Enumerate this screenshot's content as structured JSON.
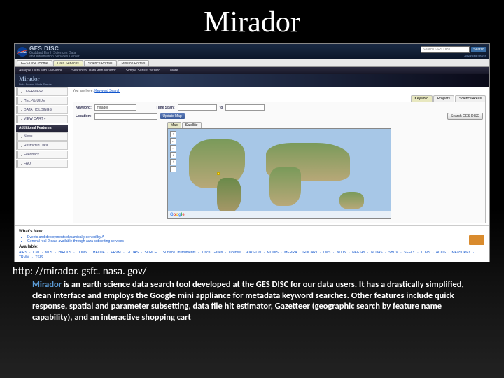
{
  "slide": {
    "title": "Mirador",
    "url": "http: //mirador. gsfc. nasa. gov/",
    "desc_link": "Mirador",
    "desc_rest": " is an earth science data search tool developed at the GES DISC for our data users. It has a drastically simplified, clean interface and employs the Google mini appliance for metadata keyword searches. Other features include quick response, spatial and parameter subsetting, data file hit estimator, Gazetteer (geographic search by feature name capability), and an interactive shopping cart"
  },
  "header": {
    "nasa": "NASA",
    "brand": "GES DISC",
    "brand_sub1": "Goddard Earth Sciences Data",
    "brand_sub2": "and Information Services Center",
    "search_placeholder": "Search GES DISC",
    "search_btn": "Search",
    "advanced": "Advanced Search"
  },
  "primary_tabs": [
    "GES DISC Home",
    "Data Services",
    "Science Portals",
    "Mission Portals"
  ],
  "sub_tabs": [
    "Analyze Data with Giovanni",
    "Search for Data with Mirador",
    "Simple Subset Wizard",
    "More"
  ],
  "mirador_title": {
    "t": "Mirador",
    "s": "Data Access Made Simple"
  },
  "sidebar": {
    "items": [
      "OVERVIEW",
      "HELP/GUIDE",
      "DATA HOLDINGS",
      "VIEW CART ▾"
    ],
    "features_head": "Additional Features",
    "features": [
      "News",
      "Restricted Data",
      "Feedback",
      "FAQ"
    ]
  },
  "breadcrumb": {
    "pre": "You are here: ",
    "link": "Keyword Search"
  },
  "result_tabs": [
    "Keyword",
    "Projects",
    "Science Areas"
  ],
  "search": {
    "kw_label": "Keyword:",
    "kw_value": "mirador",
    "time_label": "Time Span:",
    "to": "to",
    "loc_label": "Location:",
    "update": "Update Map",
    "go": "Search GES DISC"
  },
  "map": {
    "tab_map": "Map",
    "tab_sat": "Satellite",
    "zoom_items": [
      "↑",
      "←",
      "→",
      "↓",
      "+",
      "−"
    ],
    "google": [
      "G",
      "o",
      "o",
      "g",
      "l",
      "e"
    ]
  },
  "footer": {
    "whats_new": "What's New:",
    "news": [
      "Events and deployments dynamically served by A",
      "General real-2 data available through aura subsetting services"
    ],
    "available_label": "Available:",
    "available": "AIRS · CMI · MLS · HIRDLS · TOMS · HALOE · ERVM · GLDAS · SORCE · Surface Instruments · Trace Gases · License · AIRS-Cal · MODIS · MERRA · GOCART · LMS · NLON · NEESPI · NLDAS · SBUV · SEELY · TOVS · ACOS · MEaSUREs · TRMM · TSIS"
  }
}
